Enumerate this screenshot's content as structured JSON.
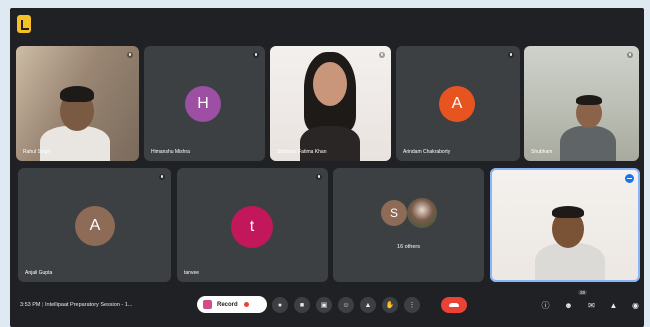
{
  "participants": [
    {
      "name": "Rahul Singh",
      "type": "camera"
    },
    {
      "name": "Himanshu Mishra",
      "type": "avatar",
      "initial": "H",
      "color": "#9c4fa3"
    },
    {
      "name": "Shahnaz Fatima Khan",
      "type": "camera"
    },
    {
      "name": "Arindam Chakraborty",
      "type": "avatar",
      "initial": "A",
      "color": "#e8541f"
    },
    {
      "name": "Shubham",
      "type": "camera"
    },
    {
      "name": "Anjali Gupta",
      "type": "avatar",
      "initial": "A",
      "color": "#8d6b56"
    },
    {
      "name": "tanvee",
      "type": "avatar",
      "initial": "t",
      "color": "#c2185b"
    },
    {
      "name": "16 others",
      "type": "group",
      "initial": "S",
      "color": "#8d6b56"
    },
    {
      "name": "",
      "type": "self"
    }
  ],
  "bottom_bar": {
    "time": "3:53 PM",
    "meeting_title": "Intellipaat Preparatory Session - 1...",
    "record_label": "Record",
    "participants_count": "28"
  },
  "icons": {
    "app": "meet-logo-icon",
    "mic": "mic-icon",
    "camera": "camera-icon",
    "captions": "captions-icon",
    "emoji": "emoji-icon",
    "present": "present-icon",
    "hand": "raise-hand-icon",
    "more": "more-options-icon",
    "end": "end-call-icon",
    "info": "info-icon",
    "people": "people-icon",
    "chat": "chat-icon",
    "activities": "activities-icon",
    "lock": "host-controls-icon"
  }
}
